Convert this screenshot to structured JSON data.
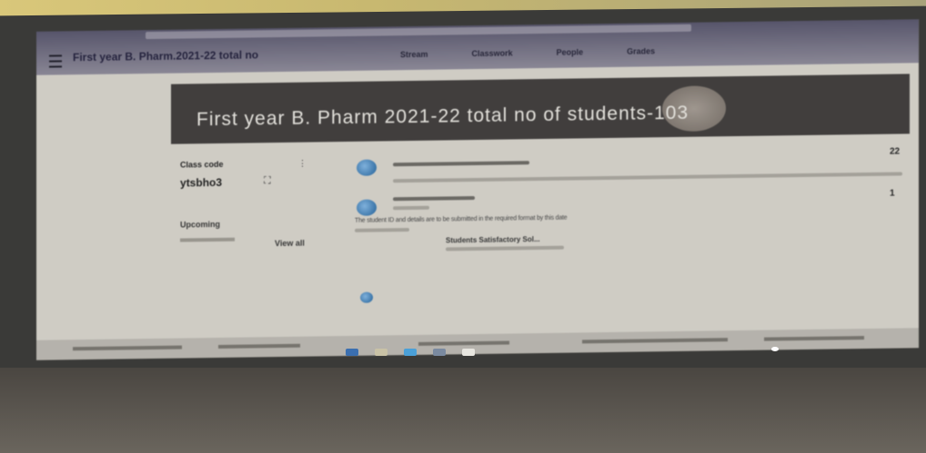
{
  "window": {
    "class_title": "First year B. Pharm.2021-22 total no"
  },
  "tabs": [
    {
      "label": "Stream"
    },
    {
      "label": "Classwork"
    },
    {
      "label": "People"
    },
    {
      "label": "Grades"
    }
  ],
  "banner": {
    "title": "First year B. Pharm 2021-22 total no of students-103"
  },
  "sidebar": {
    "stream_label": "Class code",
    "class_code": "ytsbho3",
    "upcoming_label": "Upcoming",
    "view_all_label": "View all"
  },
  "feed": {
    "post_count_top": "22",
    "post_count_second": "1",
    "post_description": "The student ID and details are to be submitted in the required format by this date",
    "attachment_title": "Students Satisfactory Sol..."
  },
  "colors": {
    "banner_bg": "#3e3b3a",
    "avatar_blue": "#1f5f98"
  }
}
